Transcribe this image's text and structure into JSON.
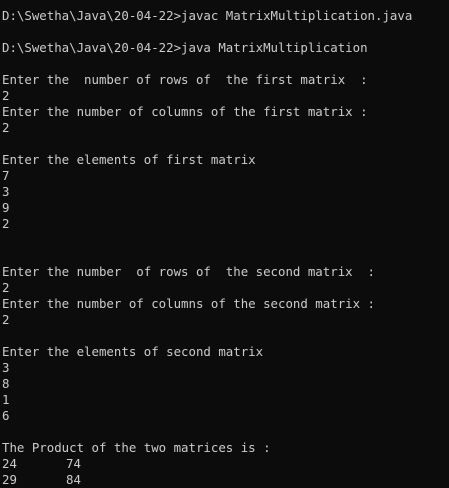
{
  "console": {
    "compile_command": "D:\\Swetha\\Java\\20-04-22>javac MatrixMultiplication.java",
    "run_command": "D:\\Swetha\\Java\\20-04-22>java MatrixMultiplication",
    "prompt_rows_first": "Enter the  number of rows of  the first matrix  :",
    "value_rows_first": "2",
    "prompt_cols_first": "Enter the number of columns of the first matrix :",
    "value_cols_first": "2",
    "prompt_elements_first": "Enter the elements of first matrix",
    "elements_first": [
      "7",
      "3",
      "9",
      "2"
    ],
    "prompt_rows_second": "Enter the number  of rows of  the second matrix  :",
    "value_rows_second": "2",
    "prompt_cols_second": "Enter the number of columns of the second matrix :",
    "value_cols_second": "2",
    "prompt_elements_second": "Enter the elements of second matrix",
    "elements_second": [
      "3",
      "8",
      "1",
      "6"
    ],
    "product_heading": "The Product of the two matrices is :",
    "product_rows": [
      [
        "24",
        "74"
      ],
      [
        "29",
        "84"
      ]
    ]
  },
  "colors": {
    "background": "#0c0c0c",
    "text": "#cccccc"
  }
}
